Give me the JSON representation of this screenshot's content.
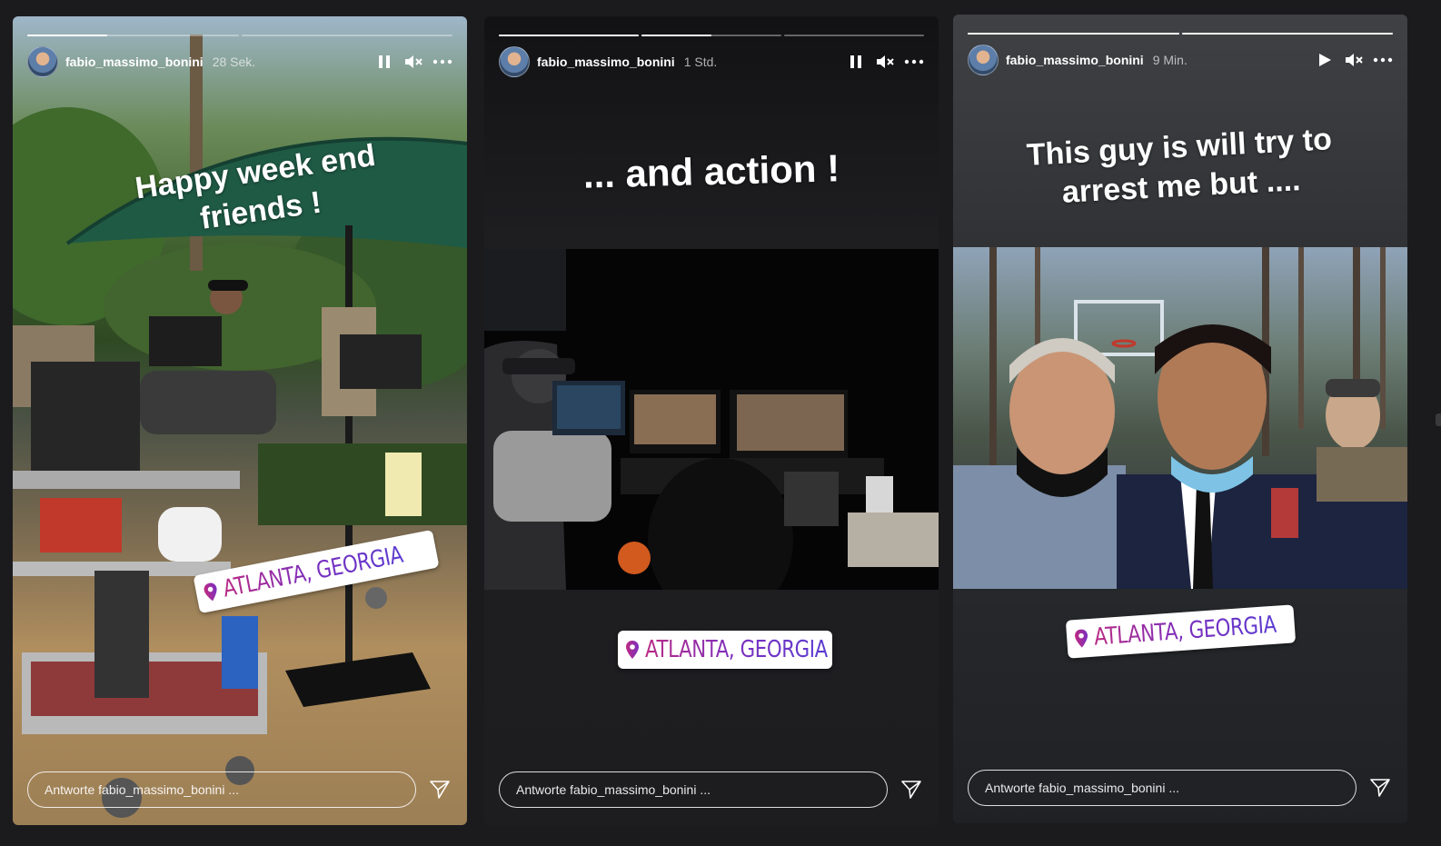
{
  "stories": [
    {
      "username": "fabio_massimo_bonini",
      "time": "28 Sek.",
      "caption": "Happy week end friends !",
      "location": "ATLANTA, GEORGIA",
      "reply_placeholder": "Antworte fabio_massimo_bonini ...",
      "playback": "paused",
      "progress_segments": [
        0.38,
        0.0
      ]
    },
    {
      "username": "fabio_massimo_bonini",
      "time": "1 Std.",
      "caption": "... and action !",
      "location": "ATLANTA, GEORGIA",
      "reply_placeholder": "Antworte fabio_massimo_bonini ...",
      "playback": "paused",
      "progress_segments": [
        1.0,
        0.5,
        0.0
      ]
    },
    {
      "username": "fabio_massimo_bonini",
      "time": "9 Min.",
      "caption": "This guy is will try to arrest me but ....",
      "location": "ATLANTA, GEORGIA",
      "reply_placeholder": "Antworte fabio_massimo_bonini ...",
      "playback": "playing",
      "progress_segments": [
        1.0,
        1.0
      ]
    }
  ],
  "icons": {
    "pause": "pause-icon",
    "play": "play-icon",
    "mute": "muted-speaker-icon",
    "more": "more-options-icon",
    "send": "send-icon",
    "location": "location-pin-icon"
  }
}
